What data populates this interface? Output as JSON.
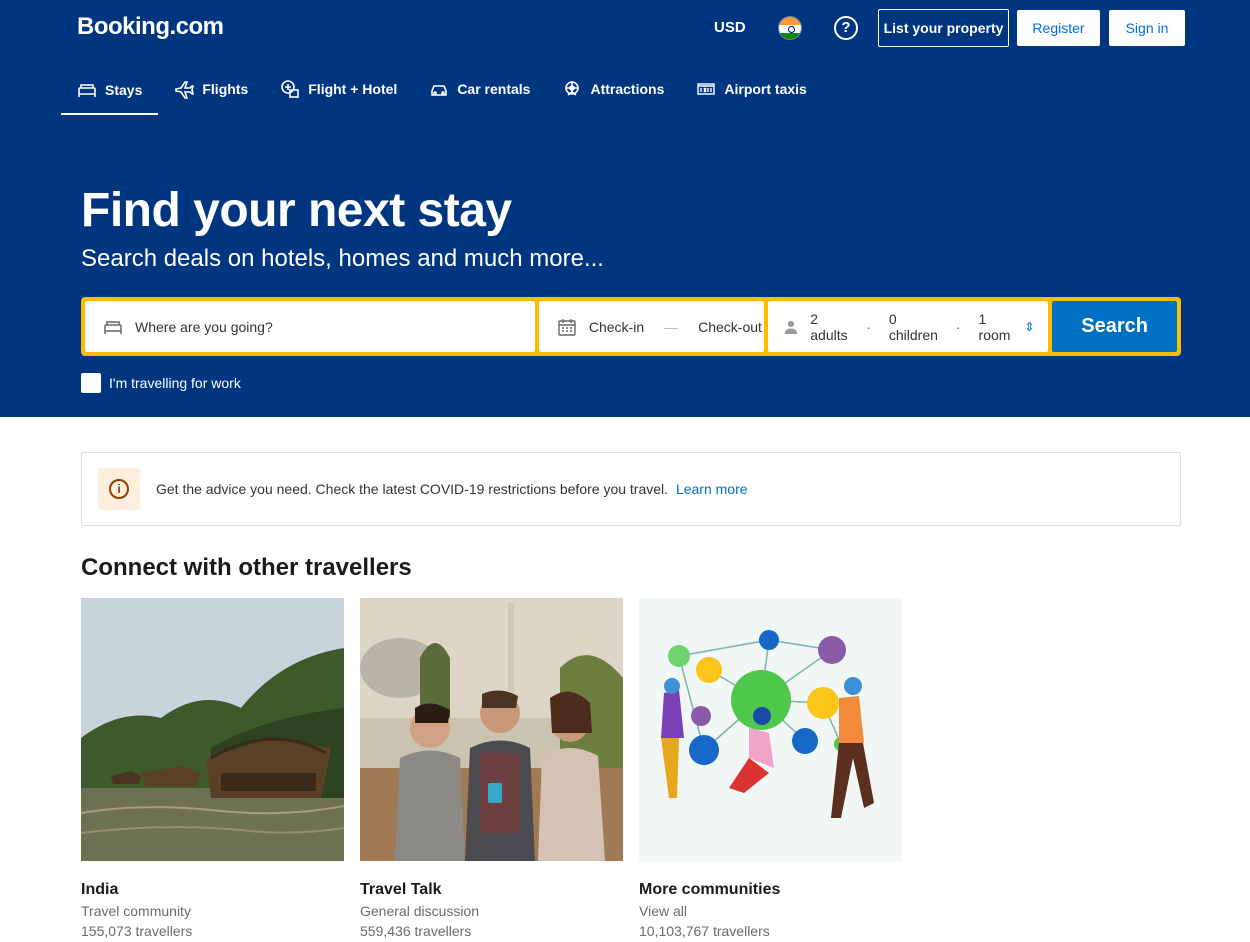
{
  "header": {
    "logo": "Booking.com",
    "currency": "USD",
    "help": "?",
    "list_property": "List your property",
    "register": "Register",
    "sign_in": "Sign in"
  },
  "nav": {
    "items": [
      {
        "label": "Stays",
        "icon": "bed-icon",
        "active": true
      },
      {
        "label": "Flights",
        "icon": "plane-icon"
      },
      {
        "label": "Flight + Hotel",
        "icon": "flight-hotel-icon"
      },
      {
        "label": "Car rentals",
        "icon": "car-icon"
      },
      {
        "label": "Attractions",
        "icon": "attractions-icon"
      },
      {
        "label": "Airport taxis",
        "icon": "taxi-icon"
      }
    ]
  },
  "hero": {
    "title": "Find your next stay",
    "subtitle": "Search deals on hotels, homes and much more..."
  },
  "search": {
    "destination_placeholder": "Where are you going?",
    "checkin": "Check-in",
    "checkout": "Check-out",
    "separator": "—",
    "adults": "2 adults",
    "children": "0 children",
    "rooms": "1 room",
    "dot": "·",
    "button": "Search",
    "work_label": "I'm travelling for work"
  },
  "notice": {
    "text": "Get the advice you need. Check the latest COVID-19 restrictions before you travel.",
    "link": "Learn more"
  },
  "section": {
    "title": "Connect with other travellers"
  },
  "communities": [
    {
      "title": "India",
      "subtitle": "Travel community",
      "count": "155,073 travellers"
    },
    {
      "title": "Travel Talk",
      "subtitle": "General discussion",
      "count": "559,436 travellers"
    },
    {
      "title": "More communities",
      "subtitle": "View all",
      "count": "10,103,767 travellers"
    }
  ],
  "colors": {
    "brand_blue": "#003580",
    "accent_yellow": "#febb02",
    "button_blue": "#0071c2"
  }
}
